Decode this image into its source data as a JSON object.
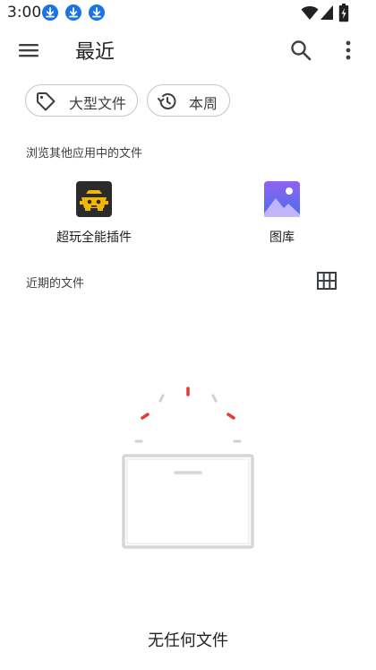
{
  "status_bar": {
    "time": "3:00",
    "left_icons": [
      "download-icon",
      "download-icon",
      "download-icon"
    ],
    "right_icons": [
      "wifi-icon",
      "cellular-signal-icon",
      "battery-charging-icon"
    ]
  },
  "app_bar": {
    "title": "最近",
    "icons": [
      "menu-icon",
      "search-icon",
      "more-vert-icon"
    ]
  },
  "chips": [
    {
      "label": "大型文件",
      "icon": "label-tag-icon"
    },
    {
      "label": "本周",
      "icon": "history-icon"
    }
  ],
  "browse_section": {
    "title": "浏览其他应用中的文件",
    "apps": [
      {
        "label": "超玩全能插件",
        "icon": "game-plugin-icon"
      },
      {
        "label": "图库",
        "icon": "gallery-icon"
      }
    ]
  },
  "recent_section": {
    "title": "近期的文件",
    "view_toggle_icon": "grid-view-icon"
  },
  "empty_state": {
    "message": "无任何文件"
  },
  "colors": {
    "background": "#ffffff",
    "chip_border": "#c4c7c5",
    "gallery_top": "#8e63f0",
    "gallery_bottom": "#4a6ef0",
    "plugin_bg": "#2b2b2b",
    "plugin_accent": "#f2b705",
    "sparkle_red": "#e53935",
    "sparkle_grey": "#d0d0d0",
    "download_blue": "#1a73e8"
  }
}
